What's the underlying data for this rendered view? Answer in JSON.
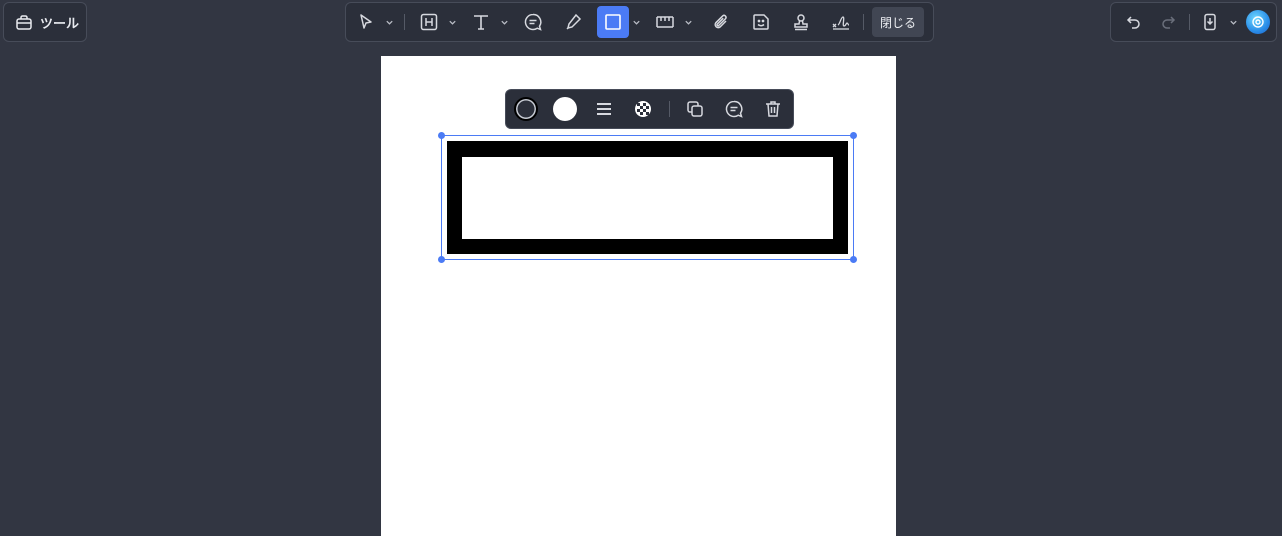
{
  "tools_panel": {
    "label": "ツール",
    "icon": "toolbox-icon"
  },
  "toolbar": {
    "tools": [
      {
        "name": "select",
        "icon": "cursor-arrow-icon",
        "has_menu": true
      },
      {
        "name": "heading",
        "icon": "heading-box-icon",
        "has_menu": true
      },
      {
        "name": "text",
        "icon": "text-t-icon",
        "has_menu": true
      },
      {
        "name": "comment",
        "icon": "comment-bubble-icon",
        "has_menu": false
      },
      {
        "name": "highlight",
        "icon": "marker-pen-icon",
        "has_menu": false
      },
      {
        "name": "rectangle",
        "icon": "rectangle-shape-icon",
        "has_menu": true,
        "active": true
      },
      {
        "name": "measure",
        "icon": "ruler-icon",
        "has_menu": true
      },
      {
        "name": "attach",
        "icon": "paperclip-icon",
        "has_menu": false
      },
      {
        "name": "sticker",
        "icon": "sticker-face-icon",
        "has_menu": false
      },
      {
        "name": "stamp",
        "icon": "stamp-icon",
        "has_menu": false
      },
      {
        "name": "signature",
        "icon": "signature-icon",
        "has_menu": false
      }
    ],
    "close_label": "閉じる"
  },
  "right_panel": {
    "undo_icon": "undo-icon",
    "redo_icon": "redo-icon",
    "redo_enabled": false,
    "save_icon": "save-device-icon",
    "assistant_icon": "ai-assistant-icon"
  },
  "shape_toolbar": {
    "stroke_color": "#000000",
    "fill_color": "#ffffff",
    "icons": [
      "stroke-color-icon",
      "fill-color-icon",
      "line-weight-icon",
      "opacity-checker-icon",
      "duplicate-icon",
      "comment-icon",
      "trash-icon"
    ]
  },
  "colors": {
    "background": "#323642",
    "panel": "#2b2f3a",
    "accent": "#4b7bf5",
    "page": "#ffffff"
  }
}
